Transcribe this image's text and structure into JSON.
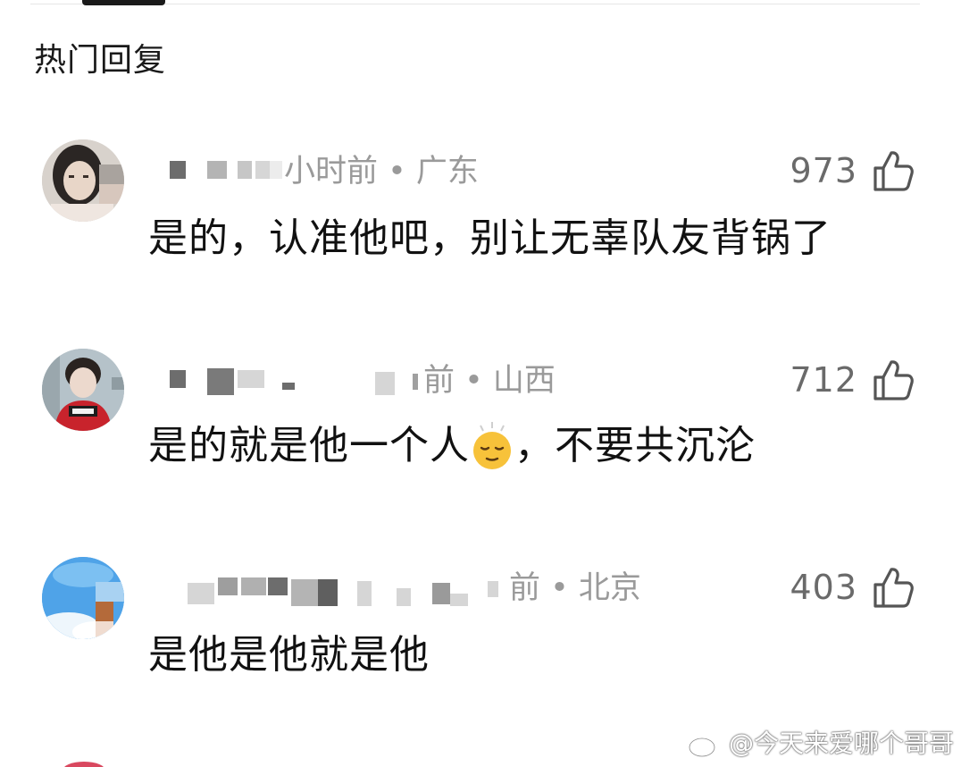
{
  "section_title": "热门回复",
  "comments": [
    {
      "meta": "小时前 • 广东",
      "likes": "973",
      "text": "是的，认准他吧，别让无辜队友背锅了"
    },
    {
      "meta": "前 • 山西",
      "likes": "712",
      "text_before_emoji": "是的就是他一个人",
      "emoji": "relieved-face-emoji",
      "text_after_emoji": "，不要共沉沦"
    },
    {
      "meta": "前 • 北京",
      "likes": "403",
      "text": "是他是他就是他"
    }
  ],
  "watermark": {
    "text": "@今天来爱哪个哥哥",
    "icon": "weibo-logo-icon"
  },
  "colors": {
    "text_primary": "#111111",
    "text_meta": "#9a9a9a",
    "like_count": "#6a6a6a",
    "background": "#ffffff"
  }
}
